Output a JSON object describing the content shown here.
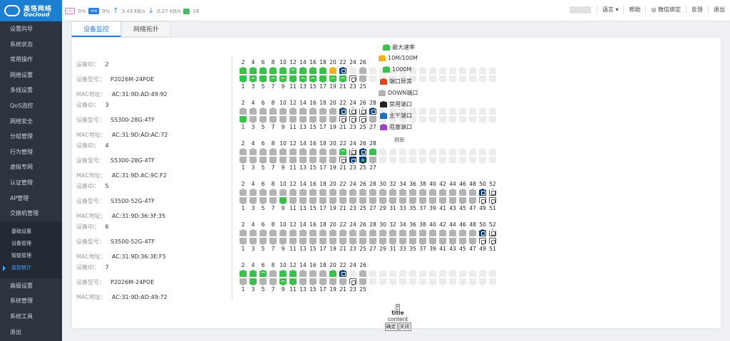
{
  "brand": {
    "name_cn": "高恪网络",
    "name_en": "Gocloud"
  },
  "stats": {
    "cpu_chip": "CPU",
    "cpu": "0%",
    "ram_chip": "RAM",
    "ram": "9%",
    "up": "3.43 KB/s",
    "down": "0.27 KB/s",
    "devices": "18"
  },
  "topmenu": {
    "language": "语言",
    "help": "帮助",
    "wechat": "微信绑定",
    "feedback": "反馈",
    "logout": "退出"
  },
  "sidebar": {
    "items_top": [
      "设置向导",
      "系统状态",
      "常用操作",
      "网络设置",
      "多线设置",
      "QoS流控",
      "网络安全",
      "分组管理",
      "行为管理",
      "虚拟专网",
      "认证管理",
      "AP管理",
      "交换机管理"
    ],
    "sub_items": [
      "基础设置",
      "设备管理",
      "智能管理",
      "监控统计"
    ],
    "active_sub": "监控统计",
    "items_bottom": [
      "高级设置",
      "系统管理",
      "系统工具",
      "退出"
    ]
  },
  "tabs": [
    "设备监控",
    "网络拓扑"
  ],
  "active_tab": "设备监控",
  "labels": {
    "id": "设备ID：",
    "model": "设备型号：",
    "mac": "MAC地址："
  },
  "devices": [
    {
      "id": "2",
      "model": "P2026M-24POE",
      "mac": "AC:31:9D:AD:49:92",
      "ports": 26,
      "top": "gggggwgggyne",
      "bottom": "gwgwwgwwgwwo"
    },
    {
      "id": "3",
      "model": "S5300-28G-4TF",
      "mac": "AC:31:9D:AD:AC:72",
      "ports": 28,
      "top": "rrrrrrrrrrnoon",
      "bottom": "grrrrrrrrrooor"
    },
    {
      "id": "4",
      "model": "S5300-28G-4TF",
      "mac": "AC:31:9D:AC:9C:F2",
      "ports": 28,
      "top": "rrrrrrrrrrwong",
      "bottom": "rrrrrrrrrrondr"
    },
    {
      "id": "5",
      "model": "S3500-52G-4TF",
      "mac": "AC:31:9D:36:3F:35",
      "ports": 52,
      "top": "rrrrrrrrrrrrrrrrrrrrrrrrno",
      "bottom": "rrrrgrrrrrrrrrrrrrrrrrrroo"
    },
    {
      "id": "6",
      "model": "S3500-52G-4TF",
      "mac": "AC:31:9D:36:3E:F5",
      "ports": 52,
      "top": "rrrrrrrrrrrrrrrrrrrrrrrrno",
      "bottom": "rrrrrrrrrrrrrrrrrrrrrrrroo"
    },
    {
      "id": "7",
      "model": "P2026M-24POE",
      "mac": "AC:31:9D:AD:49:72",
      "ports": 26,
      "top": "ggwrggrrrgne",
      "bottom": "rgrrwgrrrrro"
    }
  ],
  "legend": [
    {
      "label": "最大速率",
      "color": "#3dbf4e"
    },
    {
      "label": "10M/100M",
      "color": "#f2b21a"
    },
    {
      "label": "1000M",
      "color": "#3dbf4e"
    },
    {
      "label": "端口异常",
      "color": "#e0451e"
    },
    {
      "label": "DOWN端口",
      "color": "#b3b3b3"
    },
    {
      "label": "禁用端口",
      "color": "#222222"
    },
    {
      "label": "主干端口",
      "color": "#1a6fc4"
    },
    {
      "label": "阻塞端口",
      "color": "#a13fc9"
    }
  ],
  "refresh": "刷新",
  "dialog": {
    "close": "x",
    "title": "title",
    "content": "content",
    "ok": "确定",
    "cancel": "关闭"
  }
}
